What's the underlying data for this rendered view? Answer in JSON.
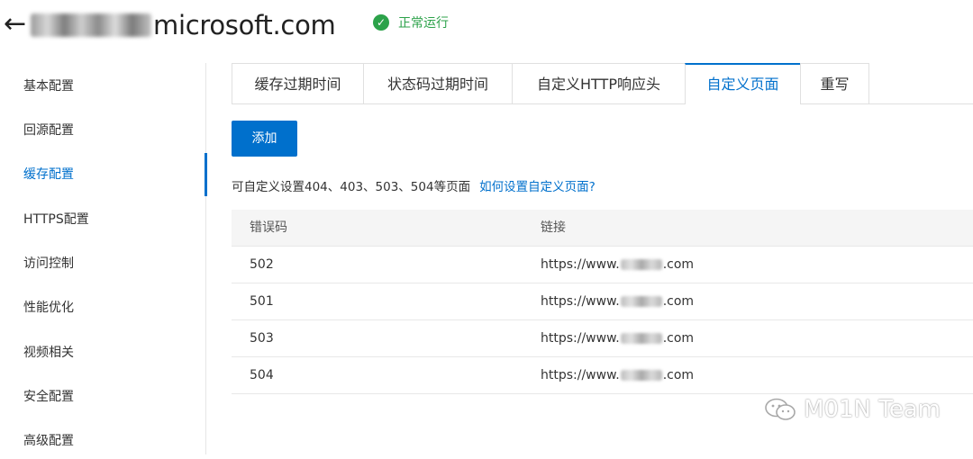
{
  "header": {
    "back_glyph": "←",
    "domain_suffix": "microsoft.com",
    "status_text": "正常运行",
    "status_color": "#2ca24a"
  },
  "sidebar": {
    "items": [
      {
        "label": "基本配置"
      },
      {
        "label": "回源配置"
      },
      {
        "label": "缓存配置",
        "active": true
      },
      {
        "label": "HTTPS配置"
      },
      {
        "label": "访问控制"
      },
      {
        "label": "性能优化"
      },
      {
        "label": "视频相关"
      },
      {
        "label": "安全配置"
      },
      {
        "label": "高级配置"
      }
    ]
  },
  "tabs": [
    {
      "label": "缓存过期时间"
    },
    {
      "label": "状态码过期时间"
    },
    {
      "label": "自定义HTTP响应头"
    },
    {
      "label": "自定义页面",
      "active": true
    },
    {
      "label": "重写"
    }
  ],
  "actions": {
    "add_label": "添加"
  },
  "description": {
    "text": "可自定义设置404、403、503、504等页面",
    "help_link": "如何设置自定义页面?"
  },
  "table": {
    "columns": [
      "错误码",
      "链接"
    ],
    "rows": [
      {
        "code": "502",
        "link_prefix": "https://www.",
        "link_suffix": ".com"
      },
      {
        "code": "501",
        "link_prefix": "https://www.",
        "link_suffix": ".com"
      },
      {
        "code": "503",
        "link_prefix": "https://www.",
        "link_suffix": ".com"
      },
      {
        "code": "504",
        "link_prefix": "https://www.",
        "link_suffix": ".com"
      }
    ]
  },
  "watermark": {
    "text": "M01N Team",
    "icon": "wechat-icon"
  },
  "colors": {
    "accent": "#0070cc",
    "success": "#2ca24a"
  }
}
